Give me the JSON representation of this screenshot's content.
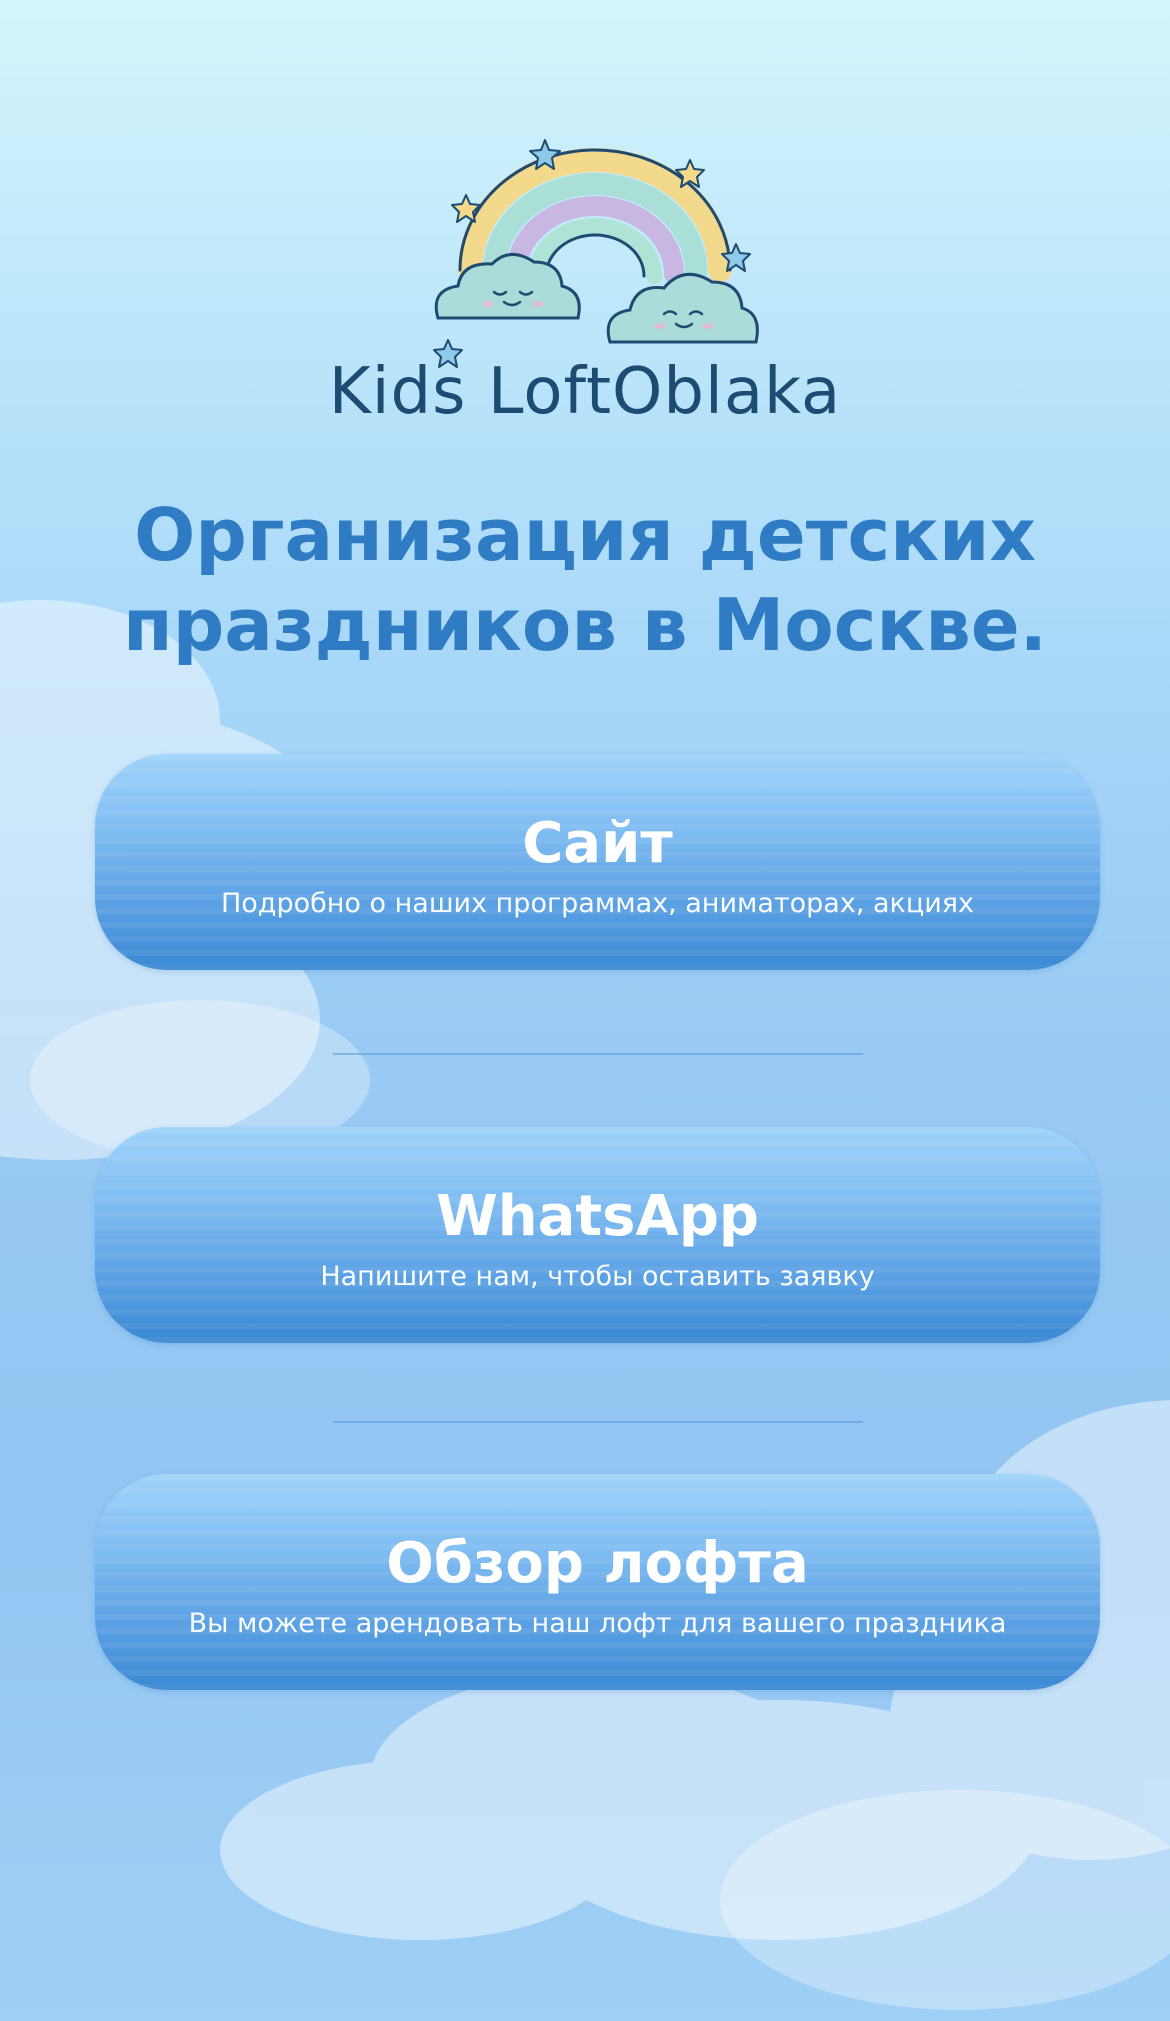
{
  "brand": {
    "name": "Kids LoftOblaka"
  },
  "headline": {
    "line1": "Организация детских",
    "line2": "праздников в Москве."
  },
  "buttons": [
    {
      "title": "Сайт",
      "subtitle": "Подробно о наших программах, аниматорах, акциях"
    },
    {
      "title": "WhatsApp",
      "subtitle": "Напишите нам, чтобы оставить заявку"
    },
    {
      "title": "Обзор лофта",
      "subtitle": "Вы можете арендовать наш лофт для вашего праздника"
    }
  ],
  "colors": {
    "headline": "#2f7cc4",
    "brand_text": "#1f4a72",
    "button_top": "#9fd3fb",
    "button_bottom": "#3a88d4",
    "button_text": "#ffffff"
  },
  "icons": [
    "rainbow-logo-icon",
    "cloud-icon",
    "star-icon"
  ]
}
